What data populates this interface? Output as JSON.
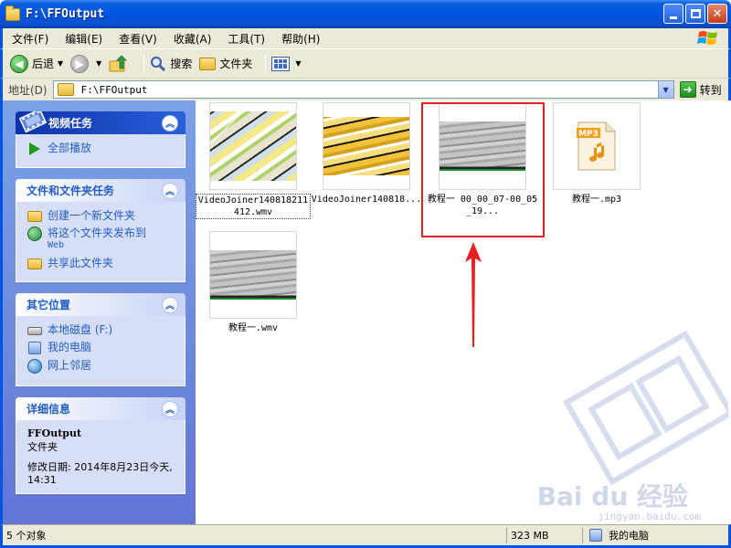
{
  "window": {
    "title": "F:\\FFOutput"
  },
  "menu": [
    "文件(F)",
    "编辑(E)",
    "查看(V)",
    "收藏(A)",
    "工具(T)",
    "帮助(H)"
  ],
  "toolbar": {
    "back": "后退",
    "search": "搜索",
    "folders": "文件夹"
  },
  "address": {
    "label": "地址(D)",
    "value": "F:\\FFOutput",
    "go": "转到"
  },
  "panels": {
    "video": {
      "title": "视频任务",
      "items": [
        "全部播放"
      ]
    },
    "file_tasks": {
      "title": "文件和文件夹任务",
      "items": [
        "创建一个新文件夹",
        "将这个文件夹发布到",
        "Web",
        "共享此文件夹"
      ]
    },
    "other": {
      "title": "其它位置",
      "items": [
        "本地磁盘 (F:)",
        "我的电脑",
        "网上邻居"
      ]
    },
    "details": {
      "title": "详细信息",
      "name": "FFOutput",
      "type": "文件夹",
      "modified": "修改日期: 2014年8月23日今天, 14:31"
    }
  },
  "files": [
    {
      "name": "VideoJoiner140818211412.wmv"
    },
    {
      "name": "VideoJoiner140818..."
    },
    {
      "name": "教程一 00_00_07-00_05_19..."
    },
    {
      "name": "教程一.mp3",
      "badge": "MP3"
    },
    {
      "name": "教程一.wmv"
    }
  ],
  "watermark": {
    "brand": "Bai du 经验",
    "sub": "jingyan.baidu.com"
  },
  "status": {
    "count": "5 个对象",
    "size": "323 MB",
    "location": "我的电脑"
  },
  "colors": {
    "xp_blue": "#0054e3",
    "panel_link": "#215dc6",
    "highlight": "#e32020"
  }
}
